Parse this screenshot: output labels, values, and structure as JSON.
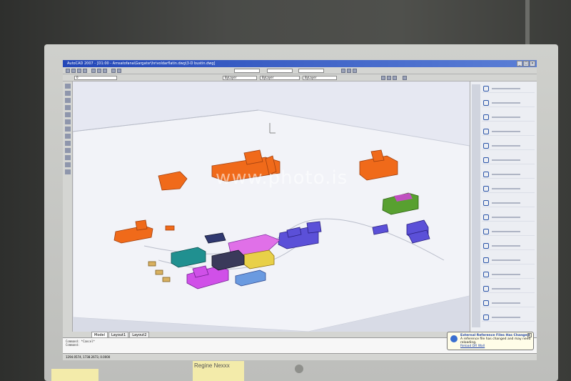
{
  "window": {
    "title": "AutoCAD 2007 - [D1:00 - Amsatofana\\Gargatsr\\hrivoldarflatin.dwg\\3-D bustin.dwg]"
  },
  "toolbar": {
    "layer_combo": "0",
    "color_combo": "ByLayer",
    "linetype_combo": "ByLayer",
    "lineweight_combo": "ByLayer"
  },
  "viewport": {
    "watermark": "www.photo.is"
  },
  "tool_palette": {
    "items": [
      "Line",
      "Construction line",
      "Polyline",
      "Polygon",
      "Rectangle",
      "Arc",
      "Circle",
      "Spline",
      "Ellipse",
      "Ellipse arc",
      "Point",
      "Hatch",
      "Gradient",
      "Region",
      "Table",
      "Multiline text",
      "Add selected"
    ]
  },
  "layout_tabs": [
    "Model",
    "Layout1",
    "Layout2"
  ],
  "command_line": {
    "lines": [
      "Command: *Cancel*",
      "Command:"
    ]
  },
  "statusbar": {
    "coords": "1294.0574, 1738.2673, 0.0000"
  },
  "notification": {
    "title": "External Reference Files Has Changed",
    "body": "A reference file has changed and may need reloading.",
    "link": "Reload DR Wall"
  },
  "sticky_notes": [
    "",
    "Regine Nexxx"
  ],
  "colors": {
    "orange_buildings": "#f06a1a",
    "blue_buildings": "#5b50d8",
    "magenta_buildings": "#d050e8",
    "teal_buildings": "#209090",
    "green_buildings": "#58a030",
    "tan_buildings": "#d8b060"
  }
}
